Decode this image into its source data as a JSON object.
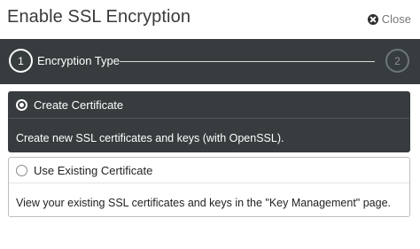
{
  "dialog": {
    "title": "Enable SSL Encryption",
    "close_label": "Close"
  },
  "stepper": {
    "steps": [
      {
        "number": "1",
        "label": "Encryption Type",
        "active": true
      },
      {
        "number": "2",
        "label": "",
        "active": false
      }
    ]
  },
  "options": [
    {
      "label": "Create Certificate",
      "description": "Create new SSL certificates and keys (with OpenSSL).",
      "selected": true
    },
    {
      "label": "Use Existing Certificate",
      "description": "View your existing SSL certificates and keys in the \"Key Management\" page.",
      "selected": false
    }
  ],
  "colors": {
    "dark_panel": "#373c3e",
    "selected_text": "#ffffff",
    "unselected_border": "#bdbdbd"
  }
}
